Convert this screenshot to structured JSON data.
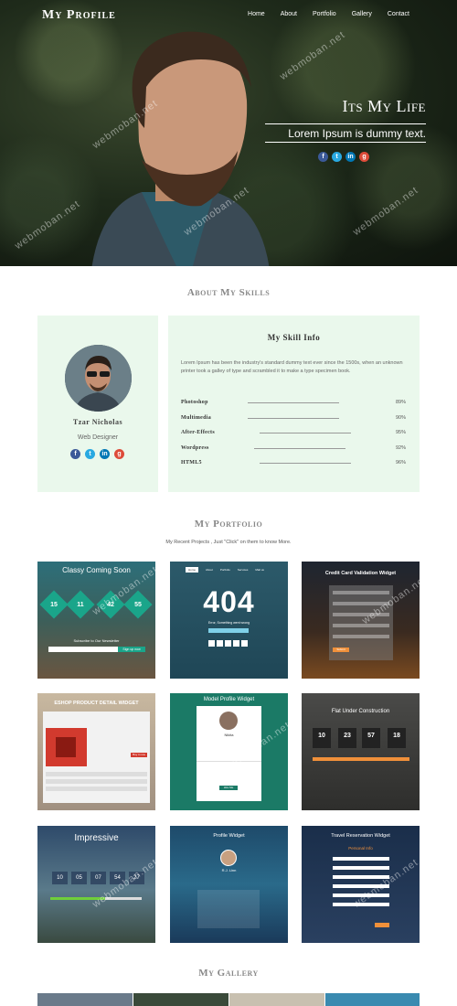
{
  "nav": {
    "logo": "My Profile",
    "items": [
      "Home",
      "About",
      "Portfolio",
      "Gallery",
      "Contact"
    ]
  },
  "hero": {
    "title": "Its My Life",
    "subtitle": "Lorem Ipsum is dummy text."
  },
  "skills": {
    "section_title": "About My Skills",
    "profile": {
      "name": "Tzar Nicholas",
      "role": "Web Designer"
    },
    "info_title": "My Skill Info",
    "description": "Lorem Ipsum has been the industry's standard dummy text ever since the 1500s, when an unknown printer took a galley of type and scrambled it to make a type specimen book.",
    "items": [
      {
        "name": "Photoshop",
        "percent": "89%"
      },
      {
        "name": "Multimedia",
        "percent": "90%"
      },
      {
        "name": "After-Effects",
        "percent": "95%"
      },
      {
        "name": "Wordpress",
        "percent": "92%"
      },
      {
        "name": "HTML5",
        "percent": "96%"
      }
    ]
  },
  "portfolio": {
    "section_title": "My Portfolio",
    "subtitle": "My Recent Projects , Just \"Click\" on them to know More.",
    "tiles": [
      {
        "title": "Classy Coming Soon",
        "numbers": [
          "15",
          "11",
          "42",
          "55"
        ],
        "note": "Subscribe to Our Newsletter",
        "btn": "Sign up now"
      },
      {
        "title": "404",
        "caption": "Error, Something went wrong",
        "menu": [
          "Home",
          "About",
          "Portfolio",
          "Services",
          "Mail us"
        ]
      },
      {
        "title": "Credit Card Validation Widget",
        "btn": "Submit"
      },
      {
        "title": "ESHOP PRODUCT DETAIL WIDGET",
        "btn": "Buy it now"
      },
      {
        "title": "Model Profile Widget",
        "name": "Nikita",
        "btn": "Hire Me"
      },
      {
        "title": "Flat Under Construction",
        "numbers": [
          "10",
          "23",
          "57",
          "18"
        ]
      },
      {
        "title": "Impressive",
        "numbers": [
          "10",
          "05",
          "07",
          "54",
          "27"
        ]
      },
      {
        "title": "Profile Widget",
        "name": "R.J. Linn"
      },
      {
        "title": "Travel Reservation Widget",
        "subtitle": "Personal Info"
      }
    ]
  },
  "gallery": {
    "section_title": "My Gallery"
  },
  "watermark": "webmoban.net",
  "colors": {
    "skill_bg": "#eaf8ec",
    "teal": "#1b7a66",
    "accent_orange": "#f0903a"
  }
}
